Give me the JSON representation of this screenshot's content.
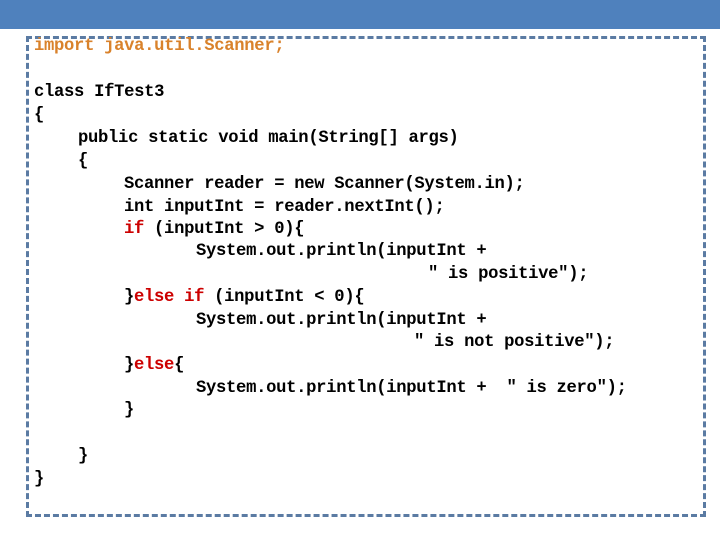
{
  "colors": {
    "header_bar": "#4f81bd",
    "border": "#5b7ba3",
    "import_text": "#d9822b",
    "keyword": "#cc0000",
    "code_text": "#000000"
  },
  "code": {
    "import_line": "import java.util.Scanner;",
    "class_decl": "class IfTest3",
    "open_class": "{",
    "main_decl": "public static void main(String[] args)",
    "open_main": "{",
    "scanner_line": "Scanner reader = new Scanner(System.in);",
    "int_line": "int inputInt = reader.nextInt();",
    "if_kw": "if",
    "if_cond": " (inputInt > 0){",
    "println_pos": "System.out.println(inputInt +",
    "str_pos": "\" is positive\");",
    "close_if": "}",
    "else_kw": "else",
    "elseif_space": " ",
    "elseif_if_kw": "if",
    "elseif_cond": " (inputInt < 0){",
    "println_neg": "System.out.println(inputInt +",
    "str_neg": "\" is not positive\");",
    "close_elseif": "}",
    "else2_kw": "else",
    "else2_brace": "{",
    "println_zero": "System.out.println(inputInt +  \" is zero\");",
    "close_else": "}",
    "close_main": "}",
    "close_class": "}"
  }
}
